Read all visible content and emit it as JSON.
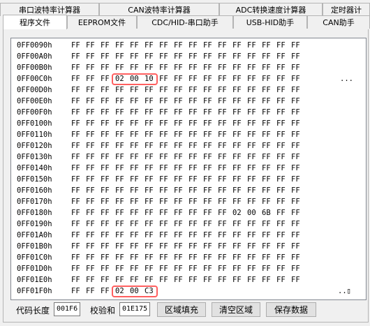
{
  "tabs_top": [
    "串口波特率计算器",
    "CAN波特率计算器",
    "ADC转换速度计算器",
    "定时器计"
  ],
  "tabs_bottom": [
    "程序文件",
    "EEPROM文件",
    "CDC/HID-串口助手",
    "USB-HID助手",
    "CAN助手"
  ],
  "active_tab": "程序文件",
  "hex_rows": [
    {
      "addr": "0FF0090h",
      "bytes": [
        "FF",
        "FF",
        "FF",
        "FF",
        "FF",
        "FF",
        "FF",
        "FF",
        "FF",
        "FF",
        "FF",
        "FF",
        "FF",
        "FF",
        "FF",
        "FF"
      ]
    },
    {
      "addr": "0FF00A0h",
      "bytes": [
        "FF",
        "FF",
        "FF",
        "FF",
        "FF",
        "FF",
        "FF",
        "FF",
        "FF",
        "FF",
        "FF",
        "FF",
        "FF",
        "FF",
        "FF",
        "FF"
      ]
    },
    {
      "addr": "0FF00B0h",
      "bytes": [
        "FF",
        "FF",
        "FF",
        "FF",
        "FF",
        "FF",
        "FF",
        "FF",
        "FF",
        "FF",
        "FF",
        "FF",
        "FF",
        "FF",
        "FF",
        "FF"
      ]
    },
    {
      "addr": "0FF00C0h",
      "bytes": [
        "FF",
        "FF",
        "FF",
        "02",
        "00",
        "10",
        "FF",
        "FF",
        "FF",
        "FF",
        "FF",
        "FF",
        "FF",
        "FF",
        "FF",
        "FF"
      ],
      "tail": "..."
    },
    {
      "addr": "0FF00D0h",
      "bytes": [
        "FF",
        "FF",
        "FF",
        "FF",
        "FF",
        "FF",
        "FF",
        "FF",
        "FF",
        "FF",
        "FF",
        "FF",
        "FF",
        "FF",
        "FF",
        "FF"
      ]
    },
    {
      "addr": "0FF00E0h",
      "bytes": [
        "FF",
        "FF",
        "FF",
        "FF",
        "FF",
        "FF",
        "FF",
        "FF",
        "FF",
        "FF",
        "FF",
        "FF",
        "FF",
        "FF",
        "FF",
        "FF"
      ]
    },
    {
      "addr": "0FF00F0h",
      "bytes": [
        "FF",
        "FF",
        "FF",
        "FF",
        "FF",
        "FF",
        "FF",
        "FF",
        "FF",
        "FF",
        "FF",
        "FF",
        "FF",
        "FF",
        "FF",
        "FF"
      ]
    },
    {
      "addr": "0FF0100h",
      "bytes": [
        "FF",
        "FF",
        "FF",
        "FF",
        "FF",
        "FF",
        "FF",
        "FF",
        "FF",
        "FF",
        "FF",
        "FF",
        "FF",
        "FF",
        "FF",
        "FF"
      ]
    },
    {
      "addr": "0FF0110h",
      "bytes": [
        "FF",
        "FF",
        "FF",
        "FF",
        "FF",
        "FF",
        "FF",
        "FF",
        "FF",
        "FF",
        "FF",
        "FF",
        "FF",
        "FF",
        "FF",
        "FF"
      ]
    },
    {
      "addr": "0FF0120h",
      "bytes": [
        "FF",
        "FF",
        "FF",
        "FF",
        "FF",
        "FF",
        "FF",
        "FF",
        "FF",
        "FF",
        "FF",
        "FF",
        "FF",
        "FF",
        "FF",
        "FF"
      ]
    },
    {
      "addr": "0FF0130h",
      "bytes": [
        "FF",
        "FF",
        "FF",
        "FF",
        "FF",
        "FF",
        "FF",
        "FF",
        "FF",
        "FF",
        "FF",
        "FF",
        "FF",
        "FF",
        "FF",
        "FF"
      ]
    },
    {
      "addr": "0FF0140h",
      "bytes": [
        "FF",
        "FF",
        "FF",
        "FF",
        "FF",
        "FF",
        "FF",
        "FF",
        "FF",
        "FF",
        "FF",
        "FF",
        "FF",
        "FF",
        "FF",
        "FF"
      ]
    },
    {
      "addr": "0FF0150h",
      "bytes": [
        "FF",
        "FF",
        "FF",
        "FF",
        "FF",
        "FF",
        "FF",
        "FF",
        "FF",
        "FF",
        "FF",
        "FF",
        "FF",
        "FF",
        "FF",
        "FF"
      ]
    },
    {
      "addr": "0FF0160h",
      "bytes": [
        "FF",
        "FF",
        "FF",
        "FF",
        "FF",
        "FF",
        "FF",
        "FF",
        "FF",
        "FF",
        "FF",
        "FF",
        "FF",
        "FF",
        "FF",
        "FF"
      ]
    },
    {
      "addr": "0FF0170h",
      "bytes": [
        "FF",
        "FF",
        "FF",
        "FF",
        "FF",
        "FF",
        "FF",
        "FF",
        "FF",
        "FF",
        "FF",
        "FF",
        "FF",
        "FF",
        "FF",
        "FF"
      ]
    },
    {
      "addr": "0FF0180h",
      "bytes": [
        "FF",
        "FF",
        "FF",
        "FF",
        "FF",
        "FF",
        "FF",
        "FF",
        "FF",
        "FF",
        "FF",
        "02",
        "00",
        "6B",
        "FF",
        "FF"
      ]
    },
    {
      "addr": "0FF0190h",
      "bytes": [
        "FF",
        "FF",
        "FF",
        "FF",
        "FF",
        "FF",
        "FF",
        "FF",
        "FF",
        "FF",
        "FF",
        "FF",
        "FF",
        "FF",
        "FF",
        "FF"
      ]
    },
    {
      "addr": "0FF01A0h",
      "bytes": [
        "FF",
        "FF",
        "FF",
        "FF",
        "FF",
        "FF",
        "FF",
        "FF",
        "FF",
        "FF",
        "FF",
        "FF",
        "FF",
        "FF",
        "FF",
        "FF"
      ]
    },
    {
      "addr": "0FF01B0h",
      "bytes": [
        "FF",
        "FF",
        "FF",
        "FF",
        "FF",
        "FF",
        "FF",
        "FF",
        "FF",
        "FF",
        "FF",
        "FF",
        "FF",
        "FF",
        "FF",
        "FF"
      ]
    },
    {
      "addr": "0FF01C0h",
      "bytes": [
        "FF",
        "FF",
        "FF",
        "FF",
        "FF",
        "FF",
        "FF",
        "FF",
        "FF",
        "FF",
        "FF",
        "FF",
        "FF",
        "FF",
        "FF",
        "FF"
      ]
    },
    {
      "addr": "0FF01D0h",
      "bytes": [
        "FF",
        "FF",
        "FF",
        "FF",
        "FF",
        "FF",
        "FF",
        "FF",
        "FF",
        "FF",
        "FF",
        "FF",
        "FF",
        "FF",
        "FF",
        "FF"
      ]
    },
    {
      "addr": "0FF01E0h",
      "bytes": [
        "FF",
        "FF",
        "FF",
        "FF",
        "FF",
        "FF",
        "FF",
        "FF",
        "FF",
        "FF",
        "FF",
        "FF",
        "FF",
        "FF",
        "FF",
        "FF"
      ]
    },
    {
      "addr": "0FF01F0h",
      "bytes": [
        "FF",
        "FF",
        "FF",
        "02",
        "00",
        "C3"
      ],
      "tail": "..▯"
    }
  ],
  "highlights": [
    {
      "row": 3,
      "start": 3,
      "end": 5
    },
    {
      "row": 22,
      "start": 3,
      "end": 5
    }
  ],
  "highlight_color": "#ff5f5f",
  "footer": {
    "code_length_label": "代码长度",
    "code_length_value": "001F6",
    "checksum_label": "校验和",
    "checksum_value": "01E175",
    "fill_button": "区域填充",
    "clear_button": "清空区域",
    "save_button": "保存数据"
  }
}
